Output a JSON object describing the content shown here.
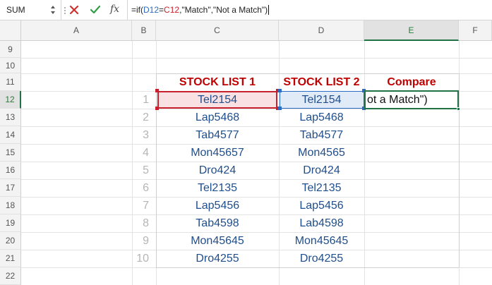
{
  "formula_bar": {
    "name_box": "SUM",
    "cancel_icon": "x-icon",
    "confirm_icon": "check-icon",
    "fx_label": "fx",
    "formula_prefix": "=if(",
    "formula_ref1": "D12",
    "formula_eq": "=",
    "formula_ref2": "C12",
    "formula_suffix": ",\"Match\",\"Not a Match\")"
  },
  "columns": [
    "A",
    "B",
    "C",
    "D",
    "E",
    "F"
  ],
  "rows": [
    "9",
    "10",
    "11",
    "12",
    "13",
    "14",
    "15",
    "16",
    "17",
    "18",
    "19",
    "20",
    "21",
    "22"
  ],
  "table": {
    "headers": {
      "stock1": "STOCK LIST 1",
      "stock2": "STOCK LIST 2",
      "compare": "Compare"
    },
    "index": [
      "1",
      "2",
      "3",
      "4",
      "5",
      "6",
      "7",
      "8",
      "9",
      "10"
    ],
    "stock1": [
      "Tel2154",
      "Lap5468",
      "Tab4577",
      "Mon45657",
      "Dro424",
      "Tel2135",
      "Lap5456",
      "Tab4598",
      "Mon45645",
      "Dro4255"
    ],
    "stock2": [
      "Tel2154",
      "Lap5468",
      "Tab4577",
      "Mon4565",
      "Dro424",
      "Tel2135",
      "Lap5456",
      "Lab4598",
      "Mon45645",
      "Dro4255"
    ],
    "editing_text": "ot a Match\")"
  },
  "colors": {
    "accent": "#217346",
    "header_red": "#c00000",
    "value_blue": "#1f4e8c",
    "ref_blue": "#2b6cc4",
    "ref_red": "#c8202c"
  }
}
